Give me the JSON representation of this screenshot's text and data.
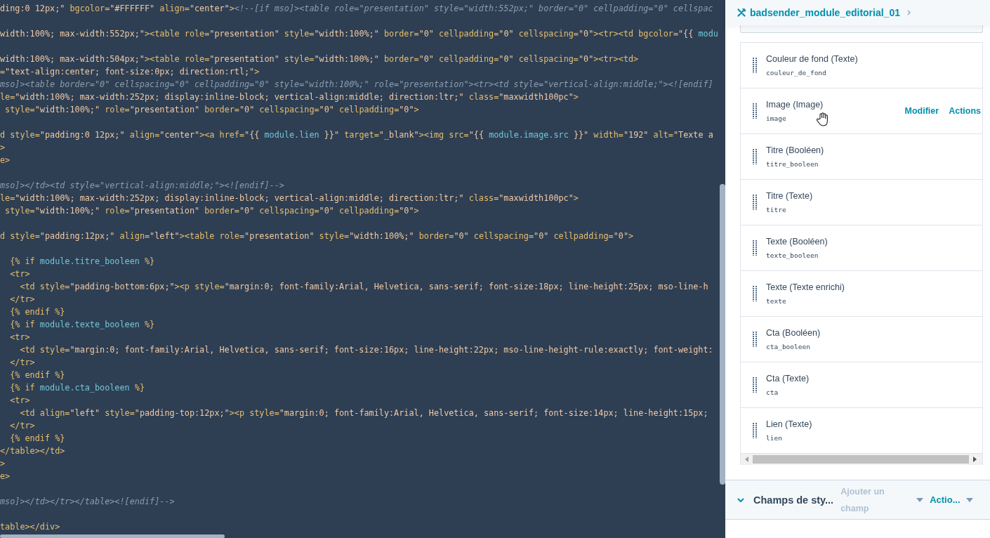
{
  "editor": {
    "lines": [
      {
        "kind": "code",
        "segments": [
          {
            "kind": "string",
            "text": "ding:0 12px;\""
          },
          {
            "kind": "markup",
            "text": " bgcolor="
          },
          {
            "kind": "string",
            "text": "\"#FFFFFF\""
          },
          {
            "kind": "markup",
            "text": " align="
          },
          {
            "kind": "string",
            "text": "\"center\""
          },
          {
            "kind": "markup",
            "text": ">"
          },
          {
            "kind": "comment",
            "text": "<!--[if mso]><table role=\"presentation\" style=\"width:552px;\" border=\"0\" cellpadding=\"0\" cellspac"
          }
        ]
      },
      {
        "kind": "blank"
      },
      {
        "kind": "code",
        "segments": [
          {
            "kind": "string",
            "text": "width:100%; max-width:552px;\""
          },
          {
            "kind": "markup",
            "text": "><table role="
          },
          {
            "kind": "string",
            "text": "\"presentation\""
          },
          {
            "kind": "markup",
            "text": " style="
          },
          {
            "kind": "string",
            "text": "\"width:100%;\""
          },
          {
            "kind": "markup",
            "text": " border="
          },
          {
            "kind": "string",
            "text": "\"0\""
          },
          {
            "kind": "markup",
            "text": " cellpadding="
          },
          {
            "kind": "string",
            "text": "\"0\""
          },
          {
            "kind": "markup",
            "text": " cellspacing="
          },
          {
            "kind": "string",
            "text": "\"0\""
          },
          {
            "kind": "markup",
            "text": "><tr><td bgcolor="
          },
          {
            "kind": "string",
            "text": "\"{{ "
          },
          {
            "kind": "variable",
            "text": "modu"
          }
        ]
      },
      {
        "kind": "blank"
      },
      {
        "kind": "code",
        "segments": [
          {
            "kind": "string",
            "text": "width:100%; max-width:504px;\""
          },
          {
            "kind": "markup",
            "text": "><table role="
          },
          {
            "kind": "string",
            "text": "\"presentation\""
          },
          {
            "kind": "markup",
            "text": " style="
          },
          {
            "kind": "string",
            "text": "\"width:100%;\""
          },
          {
            "kind": "markup",
            "text": " border="
          },
          {
            "kind": "string",
            "text": "\"0\""
          },
          {
            "kind": "markup",
            "text": " cellpadding="
          },
          {
            "kind": "string",
            "text": "\"0\""
          },
          {
            "kind": "markup",
            "text": " cellspacing="
          },
          {
            "kind": "string",
            "text": "\"0\""
          },
          {
            "kind": "markup",
            "text": "><tr><td>"
          }
        ]
      },
      {
        "kind": "code",
        "segments": [
          {
            "kind": "markup",
            "text": "="
          },
          {
            "kind": "string",
            "text": "\"text-align:center; font-size:0px; direction:rtl;\""
          },
          {
            "kind": "markup",
            "text": ">"
          }
        ]
      },
      {
        "kind": "code",
        "segments": [
          {
            "kind": "comment",
            "text": "mso]><table border=\"0\" cellspacing=\"0\" cellpadding=\"0\" style=\"width:100%;\" role=\"presentation\"><tr><td style=\"vertical-align:middle;\"><![endif]"
          }
        ]
      },
      {
        "kind": "code",
        "segments": [
          {
            "kind": "markup",
            "text": "le="
          },
          {
            "kind": "string",
            "text": "\"width:100%; max-width:252px; display:inline-block; vertical-align:middle; direction:ltr;\""
          },
          {
            "kind": "markup",
            "text": " class="
          },
          {
            "kind": "string",
            "text": "\"maxwidth100pc\""
          },
          {
            "kind": "markup",
            "text": ">"
          }
        ]
      },
      {
        "kind": "code",
        "segments": [
          {
            "kind": "markup",
            "text": " style="
          },
          {
            "kind": "string",
            "text": "\"width:100%;\""
          },
          {
            "kind": "markup",
            "text": " role="
          },
          {
            "kind": "string",
            "text": "\"presentation\""
          },
          {
            "kind": "markup",
            "text": " border="
          },
          {
            "kind": "string",
            "text": "\"0\""
          },
          {
            "kind": "markup",
            "text": " cellspacing="
          },
          {
            "kind": "string",
            "text": "\"0\""
          },
          {
            "kind": "markup",
            "text": " cellpadding="
          },
          {
            "kind": "string",
            "text": "\"0\""
          },
          {
            "kind": "markup",
            "text": ">"
          }
        ]
      },
      {
        "kind": "blank"
      },
      {
        "kind": "code",
        "segments": [
          {
            "kind": "markup",
            "text": "d style="
          },
          {
            "kind": "string",
            "text": "\"padding:0 12px;\""
          },
          {
            "kind": "markup",
            "text": " align="
          },
          {
            "kind": "string",
            "text": "\"center\""
          },
          {
            "kind": "markup",
            "text": "><a href="
          },
          {
            "kind": "string",
            "text": "\"{{ "
          },
          {
            "kind": "variable",
            "text": "module.lien"
          },
          {
            "kind": "string",
            "text": " }}\""
          },
          {
            "kind": "markup",
            "text": " target="
          },
          {
            "kind": "string",
            "text": "\"_blank\""
          },
          {
            "kind": "markup",
            "text": "><img src="
          },
          {
            "kind": "string",
            "text": "\"{{ "
          },
          {
            "kind": "variable",
            "text": "module.image.src"
          },
          {
            "kind": "string",
            "text": " }}\""
          },
          {
            "kind": "markup",
            "text": " width="
          },
          {
            "kind": "string",
            "text": "\"192\""
          },
          {
            "kind": "markup",
            "text": " alt="
          },
          {
            "kind": "string",
            "text": "\"Texte a"
          }
        ]
      },
      {
        "kind": "code",
        "segments": [
          {
            "kind": "markup",
            "text": ">"
          }
        ]
      },
      {
        "kind": "code",
        "segments": [
          {
            "kind": "markup",
            "text": "e>"
          }
        ]
      },
      {
        "kind": "blank"
      },
      {
        "kind": "code",
        "segments": [
          {
            "kind": "comment",
            "text": "mso]></td><td style=\"vertical-align:middle;\"><![endif]-->"
          }
        ]
      },
      {
        "kind": "code",
        "segments": [
          {
            "kind": "markup",
            "text": "le="
          },
          {
            "kind": "string",
            "text": "\"width:100%; max-width:252px; display:inline-block; vertical-align:middle; direction:ltr;\""
          },
          {
            "kind": "markup",
            "text": " class="
          },
          {
            "kind": "string",
            "text": "\"maxwidth100pc\""
          },
          {
            "kind": "markup",
            "text": ">"
          }
        ]
      },
      {
        "kind": "code",
        "segments": [
          {
            "kind": "markup",
            "text": " style="
          },
          {
            "kind": "string",
            "text": "\"width:100%;\""
          },
          {
            "kind": "markup",
            "text": " role="
          },
          {
            "kind": "string",
            "text": "\"presentation\""
          },
          {
            "kind": "markup",
            "text": " border="
          },
          {
            "kind": "string",
            "text": "\"0\""
          },
          {
            "kind": "markup",
            "text": " cellspacing="
          },
          {
            "kind": "string",
            "text": "\"0\""
          },
          {
            "kind": "markup",
            "text": " cellpadding="
          },
          {
            "kind": "string",
            "text": "\"0\""
          },
          {
            "kind": "markup",
            "text": ">"
          }
        ]
      },
      {
        "kind": "blank"
      },
      {
        "kind": "code",
        "segments": [
          {
            "kind": "markup",
            "text": "d style="
          },
          {
            "kind": "string",
            "text": "\"padding:12px;\""
          },
          {
            "kind": "markup",
            "text": " align="
          },
          {
            "kind": "string",
            "text": "\"left\""
          },
          {
            "kind": "markup",
            "text": "><table role="
          },
          {
            "kind": "string",
            "text": "\"presentation\""
          },
          {
            "kind": "markup",
            "text": " style="
          },
          {
            "kind": "string",
            "text": "\"width:100%;\""
          },
          {
            "kind": "markup",
            "text": " border="
          },
          {
            "kind": "string",
            "text": "\"0\""
          },
          {
            "kind": "markup",
            "text": " cellspacing="
          },
          {
            "kind": "string",
            "text": "\"0\""
          },
          {
            "kind": "markup",
            "text": " cellpadding="
          },
          {
            "kind": "string",
            "text": "\"0\""
          },
          {
            "kind": "markup",
            "text": ">"
          }
        ]
      },
      {
        "kind": "blank"
      },
      {
        "kind": "code",
        "segments": [
          {
            "kind": "markup",
            "text": "  {% if "
          },
          {
            "kind": "variable",
            "text": "module.titre_booleen"
          },
          {
            "kind": "markup",
            "text": " %}"
          }
        ]
      },
      {
        "kind": "code",
        "segments": [
          {
            "kind": "markup",
            "text": "  <tr>"
          }
        ]
      },
      {
        "kind": "code",
        "segments": [
          {
            "kind": "markup",
            "text": "    <td style="
          },
          {
            "kind": "string",
            "text": "\"padding-bottom:6px;\""
          },
          {
            "kind": "markup",
            "text": "><p style="
          },
          {
            "kind": "string",
            "text": "\"margin:0; font-family:Arial, Helvetica, sans-serif; font-size:18px; line-height:25px; mso-line-h"
          }
        ]
      },
      {
        "kind": "code",
        "segments": [
          {
            "kind": "markup",
            "text": "  </tr>"
          }
        ]
      },
      {
        "kind": "code",
        "segments": [
          {
            "kind": "markup",
            "text": "  {% endif %}"
          }
        ]
      },
      {
        "kind": "code",
        "segments": [
          {
            "kind": "markup",
            "text": "  {% if "
          },
          {
            "kind": "variable",
            "text": "module.texte_booleen"
          },
          {
            "kind": "markup",
            "text": " %}"
          }
        ]
      },
      {
        "kind": "code",
        "segments": [
          {
            "kind": "markup",
            "text": "  <tr>"
          }
        ]
      },
      {
        "kind": "code",
        "segments": [
          {
            "kind": "markup",
            "text": "    <td style="
          },
          {
            "kind": "string",
            "text": "\"margin:0; font-family:Arial, Helvetica, sans-serif; font-size:16px; line-height:22px; mso-line-height-rule:exactly; font-weight:"
          }
        ]
      },
      {
        "kind": "code",
        "segments": [
          {
            "kind": "markup",
            "text": "  </tr>"
          }
        ]
      },
      {
        "kind": "code",
        "segments": [
          {
            "kind": "markup",
            "text": "  {% endif %}"
          }
        ]
      },
      {
        "kind": "code",
        "segments": [
          {
            "kind": "markup",
            "text": "  {% if "
          },
          {
            "kind": "variable",
            "text": "module.cta_booleen"
          },
          {
            "kind": "markup",
            "text": " %}"
          }
        ]
      },
      {
        "kind": "code",
        "segments": [
          {
            "kind": "markup",
            "text": "  <tr>"
          }
        ]
      },
      {
        "kind": "code",
        "segments": [
          {
            "kind": "markup",
            "text": "    <td align="
          },
          {
            "kind": "string",
            "text": "\"left\""
          },
          {
            "kind": "markup",
            "text": " style="
          },
          {
            "kind": "string",
            "text": "\"padding-top:12px;\""
          },
          {
            "kind": "markup",
            "text": "><p style="
          },
          {
            "kind": "string",
            "text": "\"margin:0; font-family:Arial, Helvetica, sans-serif; font-size:14px; line-height:15px;"
          }
        ]
      },
      {
        "kind": "code",
        "segments": [
          {
            "kind": "markup",
            "text": "  </tr>"
          }
        ]
      },
      {
        "kind": "code",
        "segments": [
          {
            "kind": "markup",
            "text": "  {% endif %}"
          }
        ]
      },
      {
        "kind": "code",
        "segments": [
          {
            "kind": "markup",
            "text": "</table></td>"
          }
        ]
      },
      {
        "kind": "code",
        "segments": [
          {
            "kind": "markup",
            "text": ">"
          }
        ]
      },
      {
        "kind": "code",
        "segments": [
          {
            "kind": "markup",
            "text": "e>"
          }
        ]
      },
      {
        "kind": "blank"
      },
      {
        "kind": "code",
        "segments": [
          {
            "kind": "comment",
            "text": "mso]></td></tr></table><![endif]-->"
          }
        ]
      },
      {
        "kind": "blank"
      },
      {
        "kind": "code",
        "segments": [
          {
            "kind": "markup",
            "text": "table></div>"
          }
        ]
      }
    ]
  },
  "panel": {
    "title": "badsender_module_editorial_01",
    "fields": [
      {
        "label": "Couleur de fond (Texte)",
        "name": "couleur_de_fond",
        "hovered": false
      },
      {
        "label": "Image (Image)",
        "name": "image",
        "hovered": true,
        "actions": [
          "Modifier",
          "Actions"
        ]
      },
      {
        "label": "Titre (Booléen)",
        "name": "titre_booleen",
        "hovered": false
      },
      {
        "label": "Titre (Texte)",
        "name": "titre",
        "hovered": false
      },
      {
        "label": "Texte (Booléen)",
        "name": "texte_booleen",
        "hovered": false
      },
      {
        "label": "Texte (Texte enrichi)",
        "name": "texte",
        "hovered": false
      },
      {
        "label": "Cta (Booléen)",
        "name": "cta_booleen",
        "hovered": false
      },
      {
        "label": "Cta (Texte)",
        "name": "cta",
        "hovered": false
      },
      {
        "label": "Lien (Texte)",
        "name": "lien",
        "hovered": false
      }
    ],
    "style_group": {
      "title": "Champs de sty...",
      "expanded": true,
      "add_field": {
        "label": "Ajouter un champ",
        "disabled": true
      },
      "actions": {
        "label": "Actio..."
      }
    }
  }
}
